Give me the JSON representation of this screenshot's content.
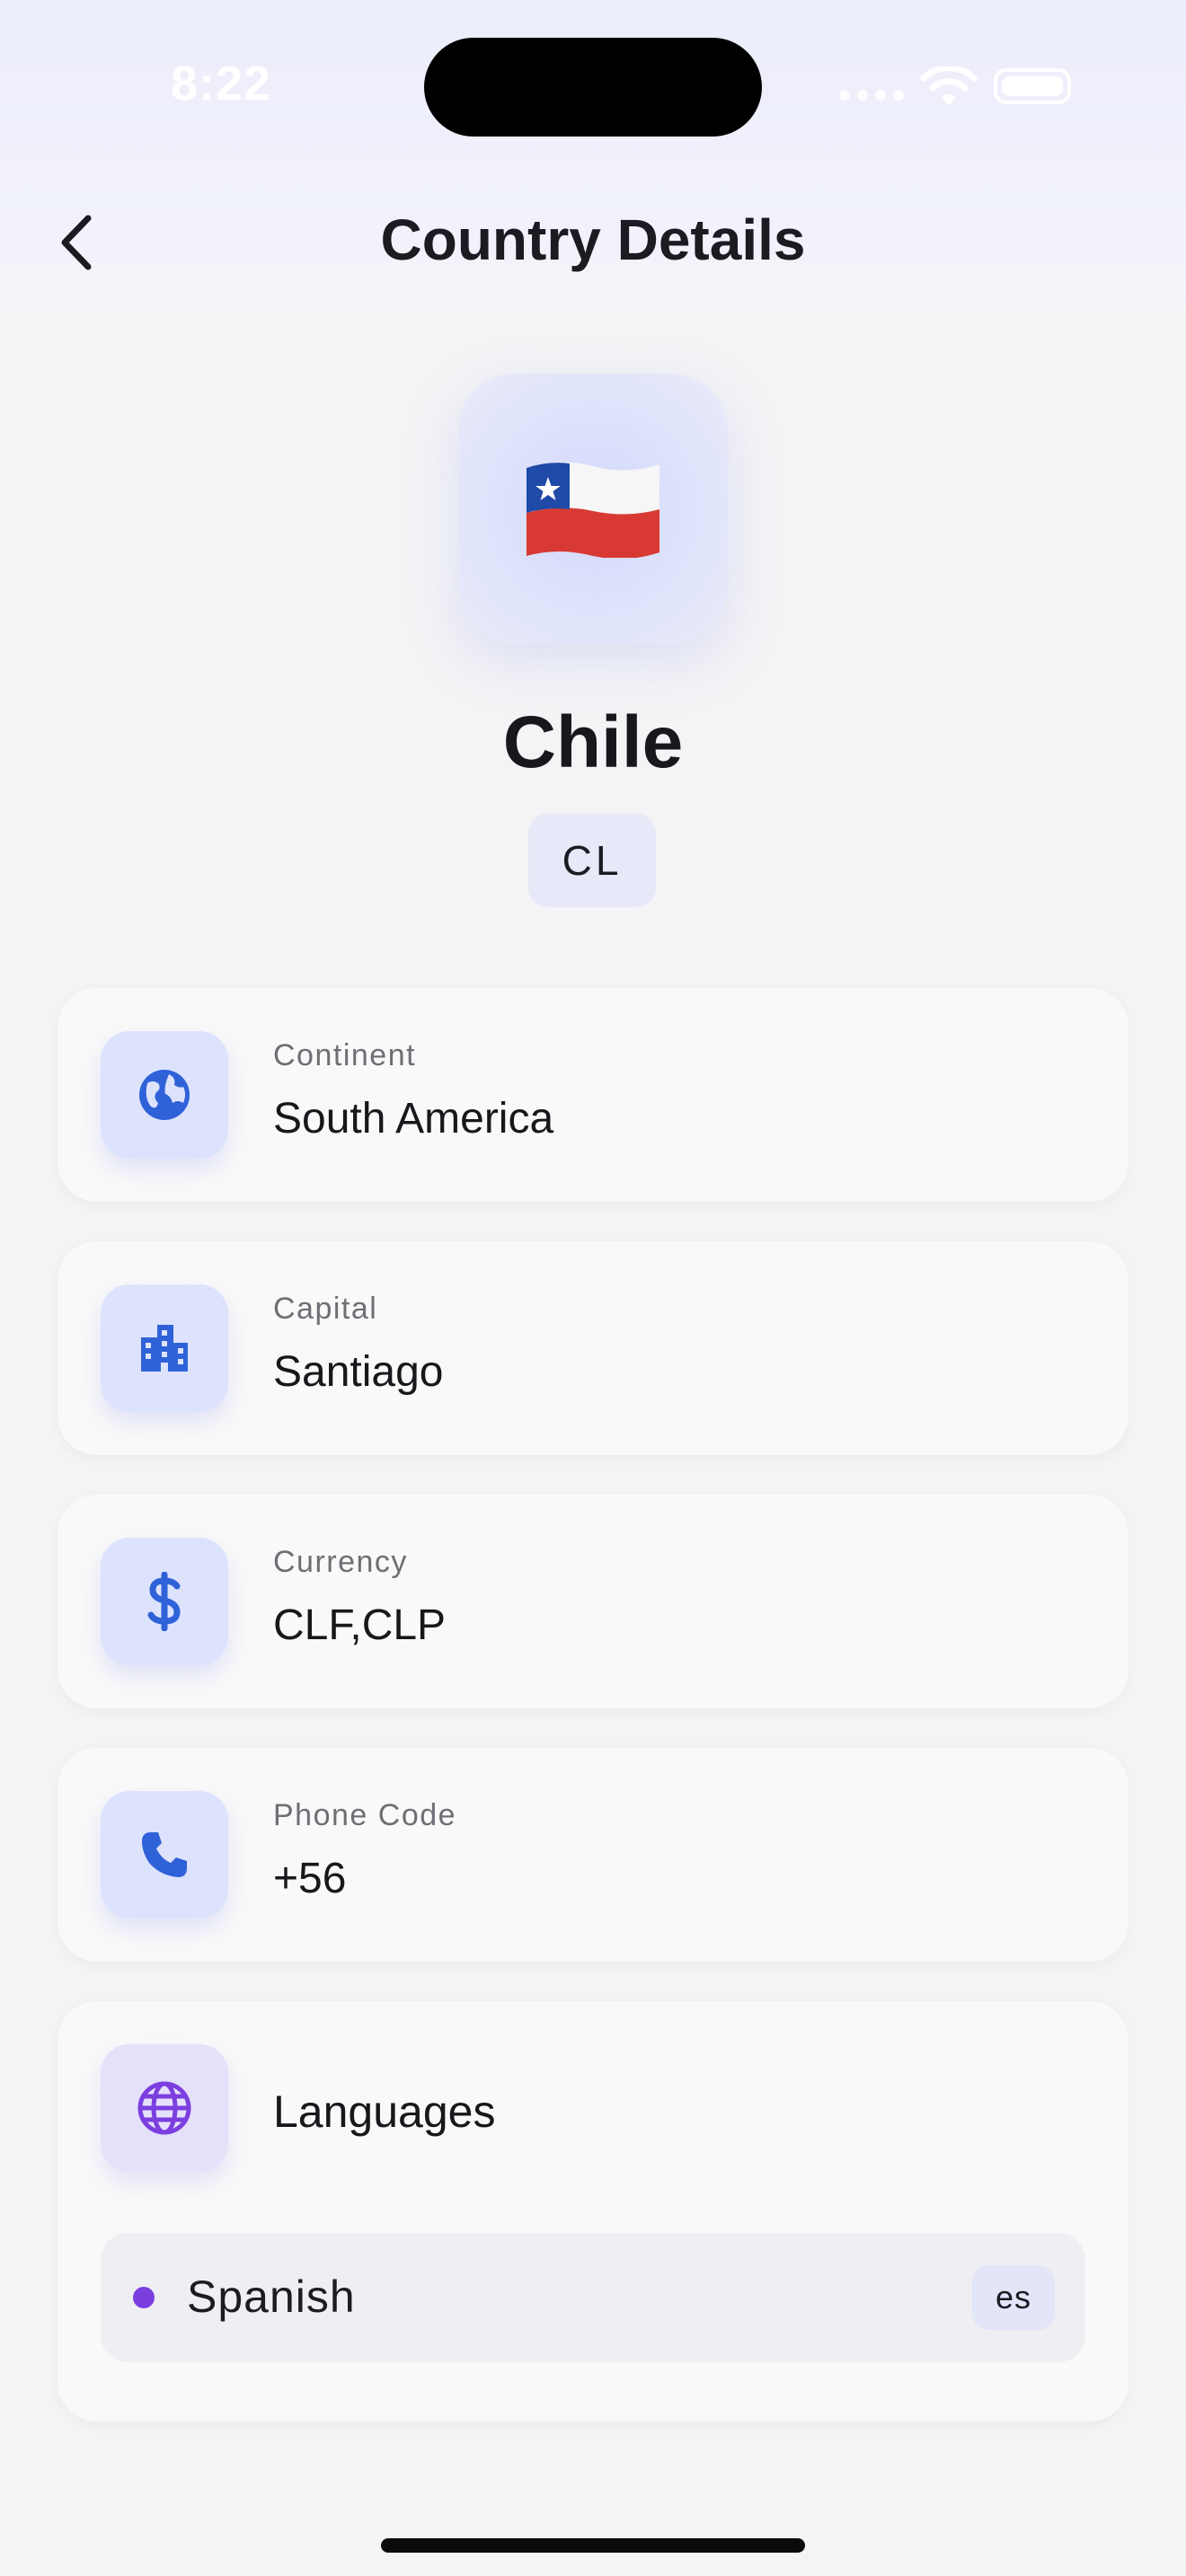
{
  "status_bar": {
    "time": "8:22"
  },
  "nav": {
    "title": "Country Details",
    "back_icon": "chevron-left-icon"
  },
  "country": {
    "flag": "🇨🇱",
    "name": "Chile",
    "code": "CL"
  },
  "details": [
    {
      "label": "Continent",
      "value": "South America",
      "icon": "globe-icon"
    },
    {
      "label": "Capital",
      "value": "Santiago",
      "icon": "building-icon"
    },
    {
      "label": "Currency",
      "value": "CLF,CLP",
      "icon": "dollar-icon"
    },
    {
      "label": "Phone Code",
      "value": "+56",
      "icon": "phone-icon"
    }
  ],
  "languages": {
    "title": "Languages",
    "icon": "language-globe-icon",
    "items": [
      {
        "name": "Spanish",
        "code": "es"
      }
    ]
  },
  "colors": {
    "accent_blue": "#2f62d8",
    "accent_purple": "#7b3fe0",
    "icon_tile_blue": "#dde3fc",
    "icon_tile_purple": "#e6e1fa",
    "background": "#f4f4f6"
  }
}
